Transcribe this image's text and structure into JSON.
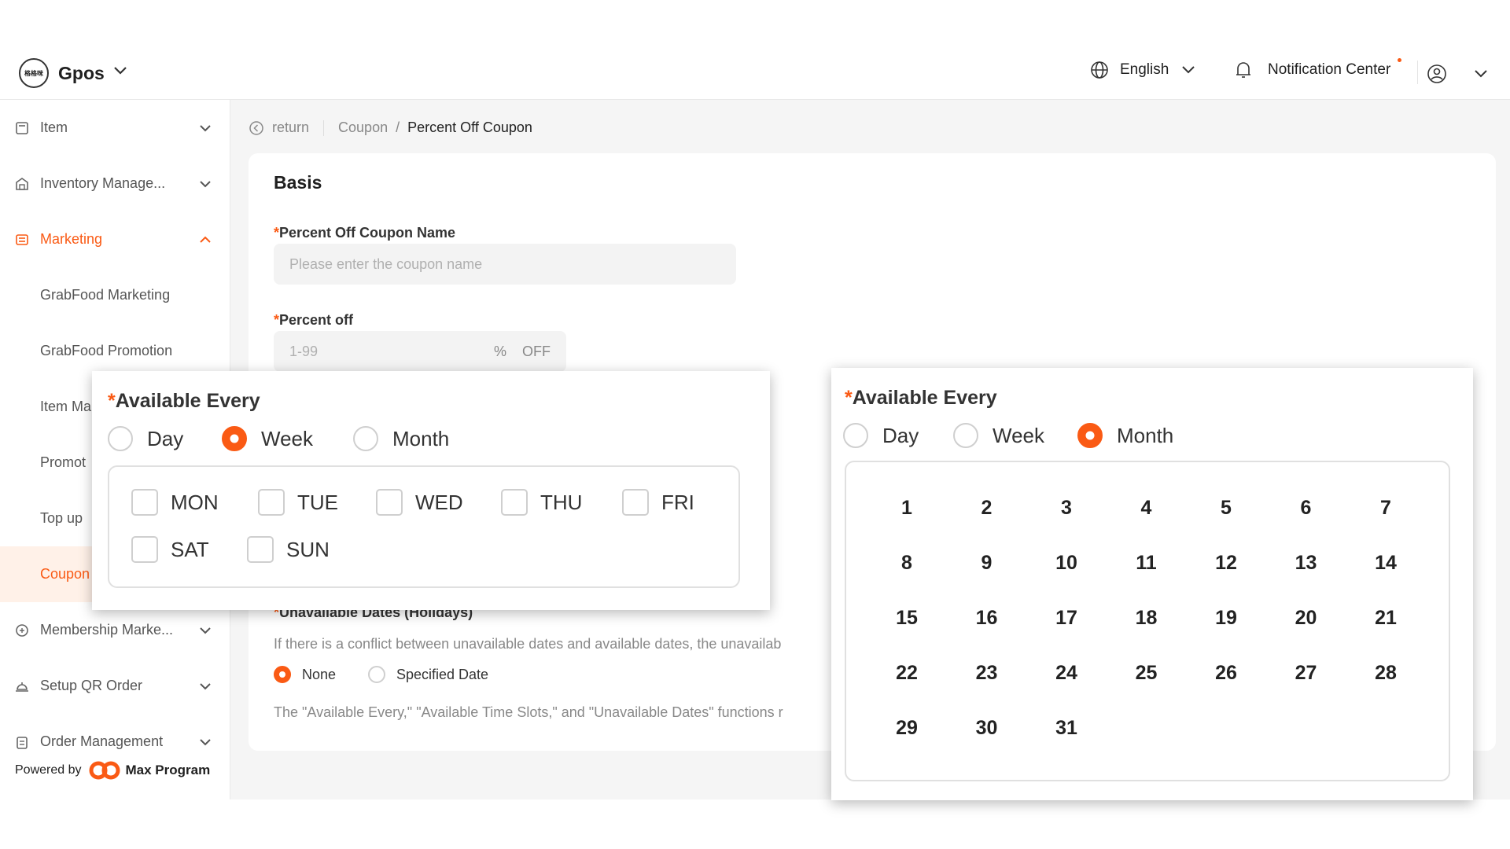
{
  "header": {
    "app_name": "Gpos",
    "logo_text": "格格咪",
    "language": "English",
    "notification": "Notification Center"
  },
  "sidebar": {
    "items": [
      {
        "label": "Item",
        "icon": "item-icon"
      },
      {
        "label": "Inventory Manage...",
        "icon": "warehouse-icon"
      },
      {
        "label": "Marketing",
        "icon": "ticket-icon"
      },
      {
        "label": "GrabFood Marketing"
      },
      {
        "label": "GrabFood Promotion"
      },
      {
        "label": "Item Ma"
      },
      {
        "label": "Promot"
      },
      {
        "label": "Top up"
      },
      {
        "label": "Coupon"
      },
      {
        "label": "Membership Marke...",
        "icon": "membership-icon"
      },
      {
        "label": "Setup QR Order",
        "icon": "service-bell-icon"
      },
      {
        "label": "Order Management",
        "icon": "clipboard-icon"
      }
    ],
    "powered_by": "Powered by",
    "powered_brand": "Max Program"
  },
  "breadcrumb": {
    "return": "return",
    "parent": "Coupon",
    "separator": "/",
    "current": "Percent Off Coupon"
  },
  "form": {
    "section_title": "Basis",
    "coupon_name_label": "Percent Off Coupon Name",
    "coupon_name_placeholder": "Please enter the coupon name",
    "percent_label": "Percent off",
    "percent_placeholder": "1-99",
    "percent_unit": "%",
    "percent_suffix": "OFF",
    "unavailable_label": "Unavailable Dates (Holidays)",
    "unavailable_hint": "If there is a conflict between unavailable dates and available dates, the unavailab",
    "unavailable_options": [
      "None",
      "Specified Date"
    ],
    "unavailable_selected": "None",
    "footer_note": "The \"Available Every,\" \"Available Time Slots,\" and \"Unavailable Dates\" functions r"
  },
  "popup_week": {
    "title": "Available Every",
    "options": [
      "Day",
      "Week",
      "Month"
    ],
    "selected": "Week",
    "weekdays": [
      "MON",
      "TUE",
      "WED",
      "THU",
      "FRI",
      "SAT",
      "SUN"
    ]
  },
  "popup_month": {
    "title": "Available Every",
    "options": [
      "Day",
      "Week",
      "Month"
    ],
    "selected": "Month",
    "days": [
      "1",
      "2",
      "3",
      "4",
      "5",
      "6",
      "7",
      "8",
      "9",
      "10",
      "11",
      "12",
      "13",
      "14",
      "15",
      "16",
      "17",
      "18",
      "19",
      "20",
      "21",
      "22",
      "23",
      "24",
      "25",
      "26",
      "27",
      "28",
      "29",
      "30",
      "31"
    ]
  },
  "colors": {
    "accent": "#fa5a14"
  }
}
